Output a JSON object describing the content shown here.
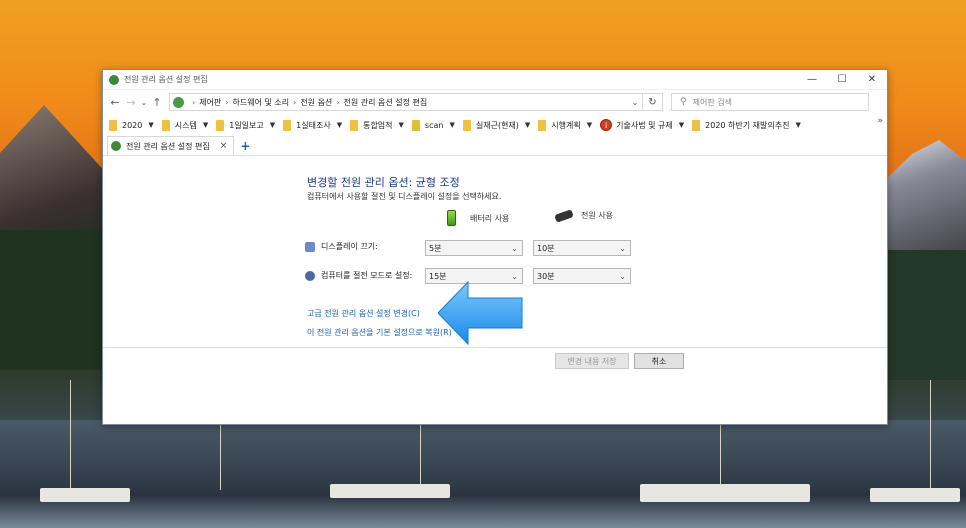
{
  "window": {
    "title": "전원 관리 옵션 설정 편집",
    "controls": {
      "minimize": "—",
      "maximize": "☐",
      "close": "✕"
    }
  },
  "nav": {
    "back": "←",
    "forward": "→",
    "recent": "⌄",
    "up": "↑"
  },
  "address": {
    "crumbs": [
      "제어판",
      "하드웨어 및 소리",
      "전원 옵션",
      "전원 관리 옵션 설정 편집"
    ],
    "dropdown": "⌄",
    "refresh": "↻"
  },
  "search": {
    "placeholder": "제어판 검색",
    "icon": "search-icon"
  },
  "favorites": [
    {
      "label": "2020",
      "icon": "folder-icon"
    },
    {
      "label": "시스템",
      "icon": "folder-icon"
    },
    {
      "label": "1일일보고",
      "icon": "folder-icon"
    },
    {
      "label": "1실태조사",
      "icon": "folder-icon"
    },
    {
      "label": "통합업적",
      "icon": "folder-icon"
    },
    {
      "label": "scan",
      "icon": "folder-icon"
    },
    {
      "label": "실재근(현재)",
      "icon": "folder-icon"
    },
    {
      "label": "시행계획",
      "icon": "folder-icon"
    },
    {
      "label": "기술사법 및 규제",
      "icon": "info-icon"
    },
    {
      "label": "2020 하반기 재발의추진",
      "icon": "folder-icon"
    }
  ],
  "favorites_more": "»",
  "tab": {
    "label": "전원 관리 옵션 설정 편집",
    "close": "×",
    "new": "+"
  },
  "content": {
    "heading": "변경할 전원 관리 옵션: 균형 조정",
    "subtext": "컴퓨터에서 사용할 절전 및 디스플레이 설정을 선택하세요.",
    "col_battery": "배터리 사용",
    "col_plugged": "전원 사용",
    "rows": [
      {
        "label": "디스플레이 끄기:",
        "battery": "5분",
        "plugged": "10분"
      },
      {
        "label": "컴퓨터를 절전 모드로 설정:",
        "battery": "15분",
        "plugged": "30분"
      }
    ],
    "link_advanced": "고급 전원 관리 옵션 설정 변경(C)",
    "link_restore": "이 전원 관리 옵션을 기본 설정으로 복원(R)",
    "btn_save": "변경 내용 저장",
    "btn_cancel": "취소"
  },
  "colors": {
    "link": "#1a5fb4",
    "heading": "#1e3a8a",
    "arrow": "#2a9ef0"
  }
}
